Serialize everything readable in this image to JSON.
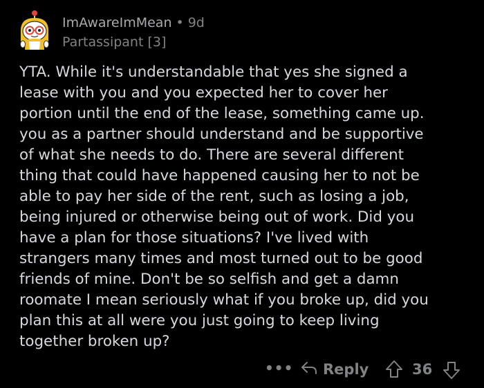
{
  "comment": {
    "author": "ImAwareImMean",
    "separator": "•",
    "age": "9d",
    "flair": "Partassipant [3]",
    "avatar_icon": "snoo-avatar-icon",
    "body": "YTA. While it's understandable that yes she signed a\nlease with you and you expected her to cover her\nportion until the end of the lease, something came up.\nyou as a partner should understand and be supportive\nof what she needs to do. There are several different\nthing that could have happened causing her to not be\nable to pay her side of the rent, such as losing a job,\nbeing injured or otherwise being out of work. Did you\nhave a plan for those situations? I've lived with\nstrangers many times and most turned out to be good\nfriends of mine. Don't be so selfish and get a damn\nroomate I mean seriously what if you broke up, did you\nplan this at all were you just going to keep living\ntogether broken up?"
  },
  "actions": {
    "more_label": "•••",
    "more_icon": "more-options-icon",
    "reply_icon": "reply-arrow-icon",
    "reply_label": "Reply",
    "upvote_icon": "upvote-arrow-icon",
    "score": "36",
    "downvote_icon": "downvote-arrow-icon"
  },
  "colors": {
    "background": "#000000",
    "text": "#d7dadc",
    "muted": "#818384"
  }
}
